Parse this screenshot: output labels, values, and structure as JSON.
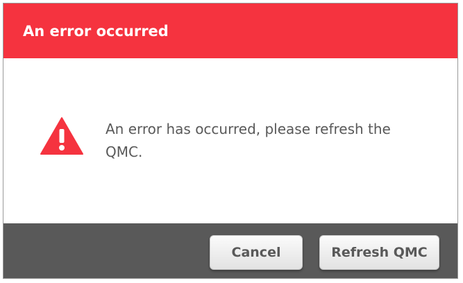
{
  "dialog": {
    "title": "An error occurred",
    "message": "An error has occurred, please refresh the QMC.",
    "icon": "warning-icon",
    "buttons": {
      "cancel_label": "Cancel",
      "refresh_label": "Refresh QMC"
    }
  },
  "colors": {
    "header": "#f5333f",
    "footer": "#595959",
    "icon": "#f5333f",
    "text": "#595959"
  }
}
